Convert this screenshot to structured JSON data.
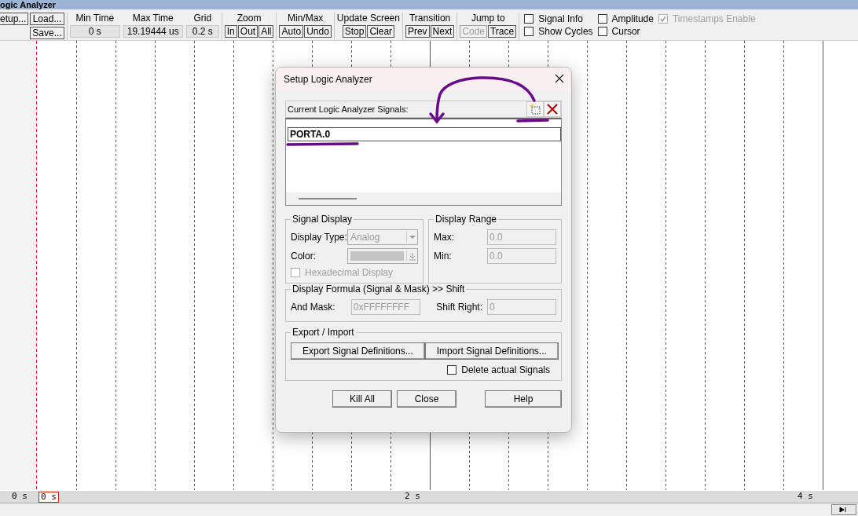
{
  "window": {
    "title": "ogic Analyzer"
  },
  "toolbar": {
    "file_buttons": [
      {
        "label": "etup..."
      },
      {
        "label": "Load..."
      },
      {
        "label": "Save..."
      }
    ],
    "fields": [
      {
        "label": "Min Time",
        "value": "0 s"
      },
      {
        "label": "Max Time",
        "value": "19.19444 us"
      },
      {
        "label": "Grid",
        "value": "0.2 s"
      }
    ],
    "button_groups": [
      {
        "title": "Zoom",
        "buttons": [
          {
            "label": "In",
            "disabled": false
          },
          {
            "label": "Out",
            "disabled": false
          },
          {
            "label": "All",
            "disabled": false
          }
        ]
      },
      {
        "title": "Min/Max",
        "buttons": [
          {
            "label": "Auto",
            "disabled": false
          },
          {
            "label": "Undo",
            "disabled": false
          }
        ]
      },
      {
        "title": "Update Screen",
        "buttons": [
          {
            "label": "Stop",
            "disabled": false
          },
          {
            "label": "Clear",
            "disabled": false
          }
        ]
      },
      {
        "title": "Transition",
        "buttons": [
          {
            "label": "Prev",
            "disabled": false
          },
          {
            "label": "Next",
            "disabled": false
          }
        ]
      },
      {
        "title": "Jump to",
        "buttons": [
          {
            "label": "Code",
            "disabled": true
          },
          {
            "label": "Trace",
            "disabled": false
          }
        ]
      }
    ],
    "checkboxes": [
      {
        "label": "Signal Info",
        "checked": false,
        "disabled": false
      },
      {
        "label": "Show Cycles",
        "checked": false,
        "disabled": false
      },
      {
        "label": "Amplitude",
        "checked": false,
        "disabled": false
      },
      {
        "label": "Cursor",
        "checked": false,
        "disabled": false
      },
      {
        "label": "Timestamps Enable",
        "checked": true,
        "disabled": true
      }
    ]
  },
  "time_axis": {
    "start_label": "0 s",
    "cursor_label": "0 s",
    "labels": [
      "2 s",
      "4 s"
    ]
  },
  "dialog": {
    "title": "Setup Logic Analyzer",
    "signals_label": "Current Logic Analyzer Signals:",
    "signals": [
      {
        "name": "PORTA.0",
        "selected": true
      }
    ],
    "signal_display": {
      "title": "Signal Display",
      "display_type_label": "Display Type:",
      "display_type_value": "Analog",
      "color_label": "Color:",
      "hex_checkbox": {
        "label": "Hexadecimal Display",
        "checked": false,
        "disabled": true
      }
    },
    "display_range": {
      "title": "Display Range",
      "max_label": "Max:",
      "max_value": "0.0",
      "min_label": "Min:",
      "min_value": "0.0"
    },
    "formula": {
      "title": "Display Formula (Signal & Mask) >> Shift",
      "and_mask_label": "And Mask:",
      "and_mask_value": "0xFFFFFFFF",
      "shift_label": "Shift Right:",
      "shift_value": "0"
    },
    "export_import": {
      "title": "Export / Import",
      "export_button": "Export Signal Definitions...",
      "import_button": "Import Signal Definitions...",
      "delete_checkbox": {
        "label": "Delete actual Signals",
        "checked": false
      }
    },
    "buttons": [
      "Kill All",
      "Close",
      "Help"
    ]
  }
}
